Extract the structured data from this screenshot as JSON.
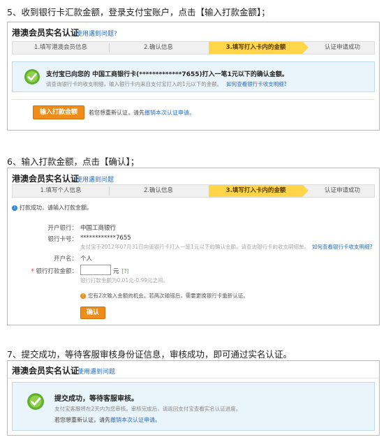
{
  "sections": [
    {
      "heading": "5、收到银行卡汇款金额，登录支付宝账户，点击【输入打款金额】；",
      "panel_title": "港澳会员实名认证",
      "help_link": "使用遇到问题?",
      "steps": [
        "1.填写港澳会员信息",
        "2.确认信息",
        "3.填写打入卡内的金额",
        "认证申请成功"
      ],
      "message": "支付宝已向您的 中国工商银行卡(*************7655)打入一笔1元以下的确认金额。",
      "sub_message": "请查询银行卡的收支明细，输入银行卡内来自支付宝打入的1元以下的金额。",
      "sub_link": "如何查看银行卡收支明细?",
      "button": "输入打款金额",
      "resubmit_text": "若您想重新认证，请先",
      "resubmit_link": "撤销本次认证申请。"
    },
    {
      "heading": "6、输入打款金额，点击【确认】；",
      "panel_title": "港澳会员实名认证",
      "help_link": "使用遇到问题",
      "steps": [
        "1.填写个人信息",
        "2.确认信息",
        "3.填写打入卡内的金额",
        "认证申请成功"
      ],
      "notice": "打款成功，请输入打款金额。",
      "bank_label": "开户银行：",
      "bank_value": "中国工商银行",
      "card_label": "银行卡号：",
      "card_value": "************7655",
      "card_hint": "支付宝于2012年07月31日向该银行卡打入一笔1元以下的确认金额，请查询银行卡的收支明细单。",
      "card_link": "如何查看银行卡收支明细?",
      "holder_label": "开户名：",
      "holder_value": "个人",
      "amount_label": "银行打款金额：",
      "amount_unit": "元",
      "amount_check": "[?]",
      "amount_hint": "银行打款金额为0.01元-0.99元之间。",
      "chances_text": "您有2次输入金额的机会。若两次输错后，需要更换银行卡重新认证。",
      "confirm_button": "确认"
    },
    {
      "heading": "7、提交成功，等待客服审核身份证信息，审核成功，即可通过实名认证。",
      "panel_title": "港澳会员实名认证",
      "help_link": "使用遇到问题",
      "message": "提交成功，等待客服审核。",
      "sub_message": "支付宝客服将在2天内为您审核。审核完成后，请返回支付宝查看实名认证进度。",
      "resubmit_text": "若您想重新认证，请先",
      "resubmit_link": "撤销本次认证申请。"
    }
  ],
  "colors": {
    "accent": "#f08c1a",
    "active_step": "#ffd54a",
    "link": "#2a6cc0",
    "info_bg": "#eaf4fb"
  }
}
